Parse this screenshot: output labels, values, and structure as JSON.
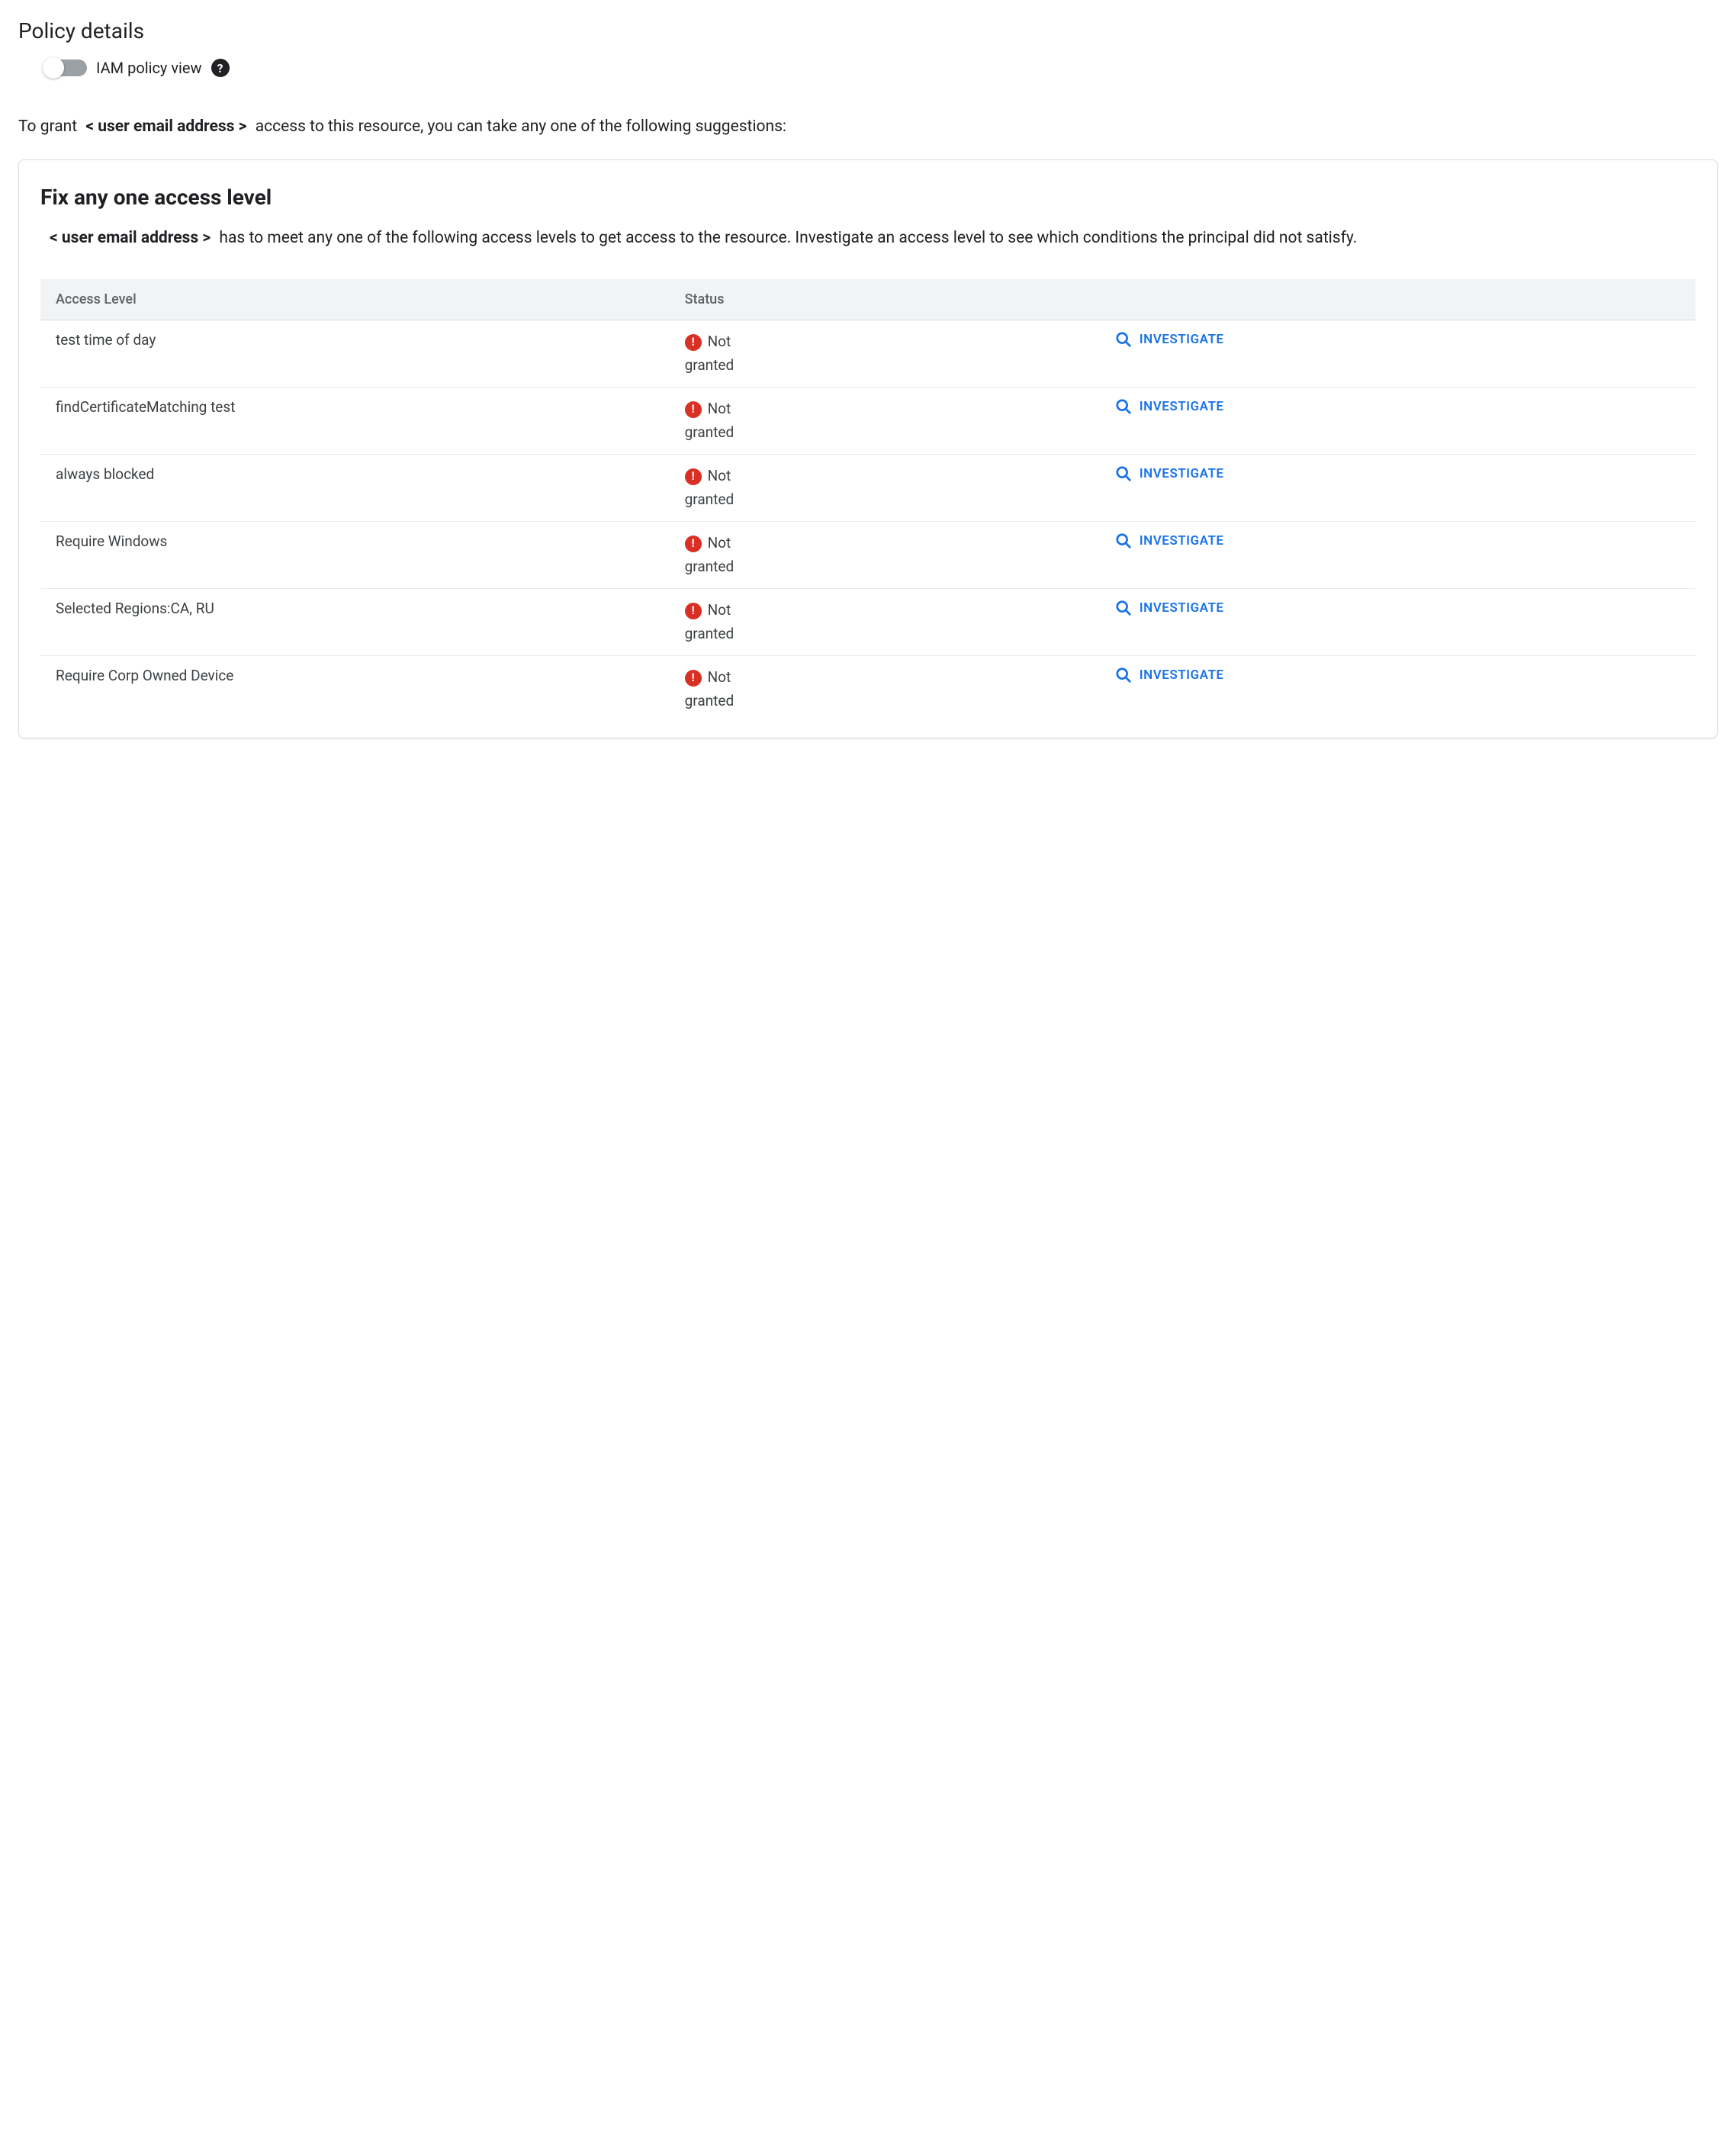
{
  "page": {
    "title": "Policy details"
  },
  "toggle": {
    "label": "IAM policy view"
  },
  "intro": {
    "pre": "To grant",
    "placeholder": "< user email address >",
    "post": "access to this resource, you can take any one of the following suggestions:"
  },
  "card": {
    "title": "Fix any one access level",
    "desc_placeholder": "< user email address >",
    "desc_rest": "has to meet any one of the following access levels to get access to the resource. Investigate an access level to see which conditions the principal did not satisfy."
  },
  "table": {
    "headers": {
      "level": "Access Level",
      "status": "Status"
    },
    "status_text_1": "Not",
    "status_text_2": "granted",
    "investigate_label": "INVESTIGATE",
    "rows": [
      {
        "level": "test time of day"
      },
      {
        "level": "findCertificateMatching test"
      },
      {
        "level": "always blocked"
      },
      {
        "level": "Require Windows"
      },
      {
        "level": "Selected Regions:CA, RU"
      },
      {
        "level": "Require Corp Owned Device"
      }
    ]
  }
}
